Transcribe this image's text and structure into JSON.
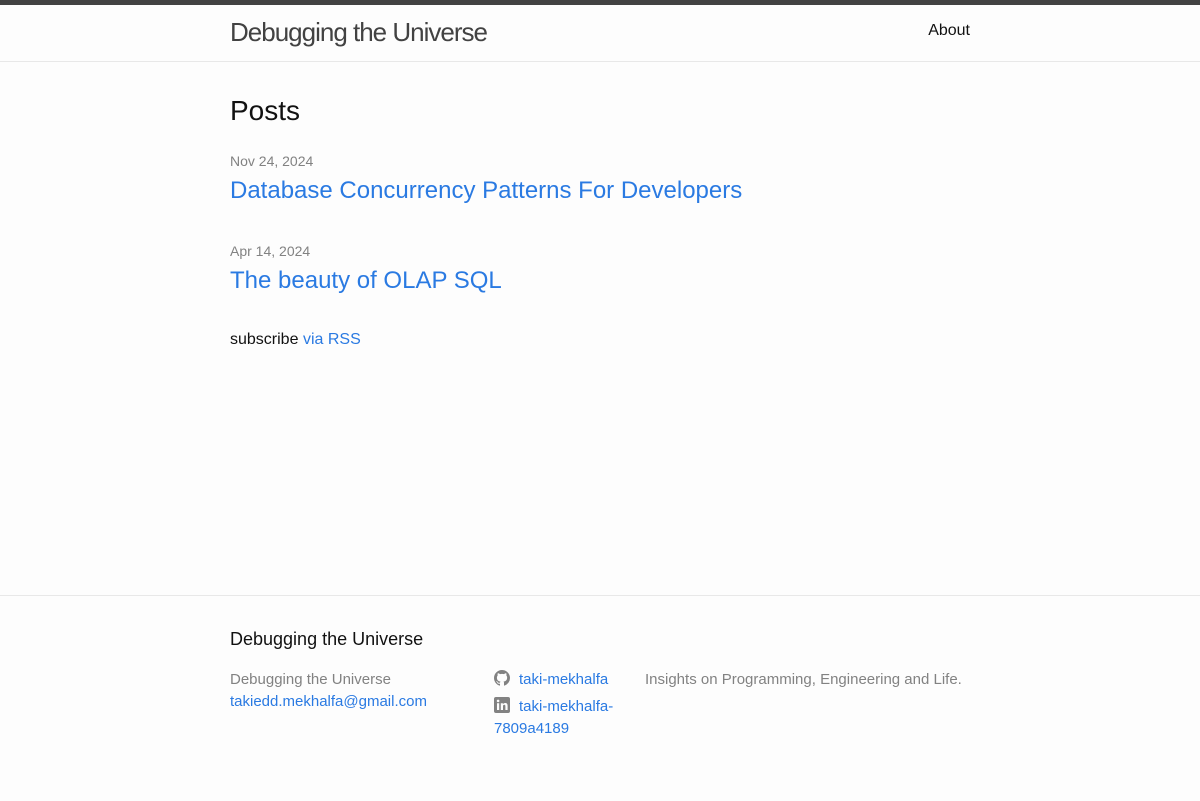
{
  "header": {
    "site_title": "Debugging the Universe",
    "nav": [
      {
        "label": "About"
      }
    ]
  },
  "main": {
    "heading": "Posts",
    "posts": [
      {
        "date": "Nov 24, 2024",
        "title": "Database Concurrency Patterns For Developers"
      },
      {
        "date": "Apr 14, 2024",
        "title": "The beauty of OLAP SQL"
      }
    ],
    "subscribe_text": "subscribe",
    "rss_link": "via RSS"
  },
  "footer": {
    "heading": "Debugging the Universe",
    "name": "Debugging the Universe",
    "email": "takiedd.mekhalfa@gmail.com",
    "github": {
      "icon": "github-icon",
      "label": "taki-mekhalfa"
    },
    "linkedin": {
      "icon": "linkedin-icon",
      "label": "taki-mekhalfa-7809a4189"
    },
    "description": "Insights on Programming, Engineering and Life."
  },
  "colors": {
    "link": "#2a7ae2",
    "topbar": "#424242",
    "meta": "#828282",
    "border": "#e8e8e8",
    "background": "#fdfdfd"
  }
}
